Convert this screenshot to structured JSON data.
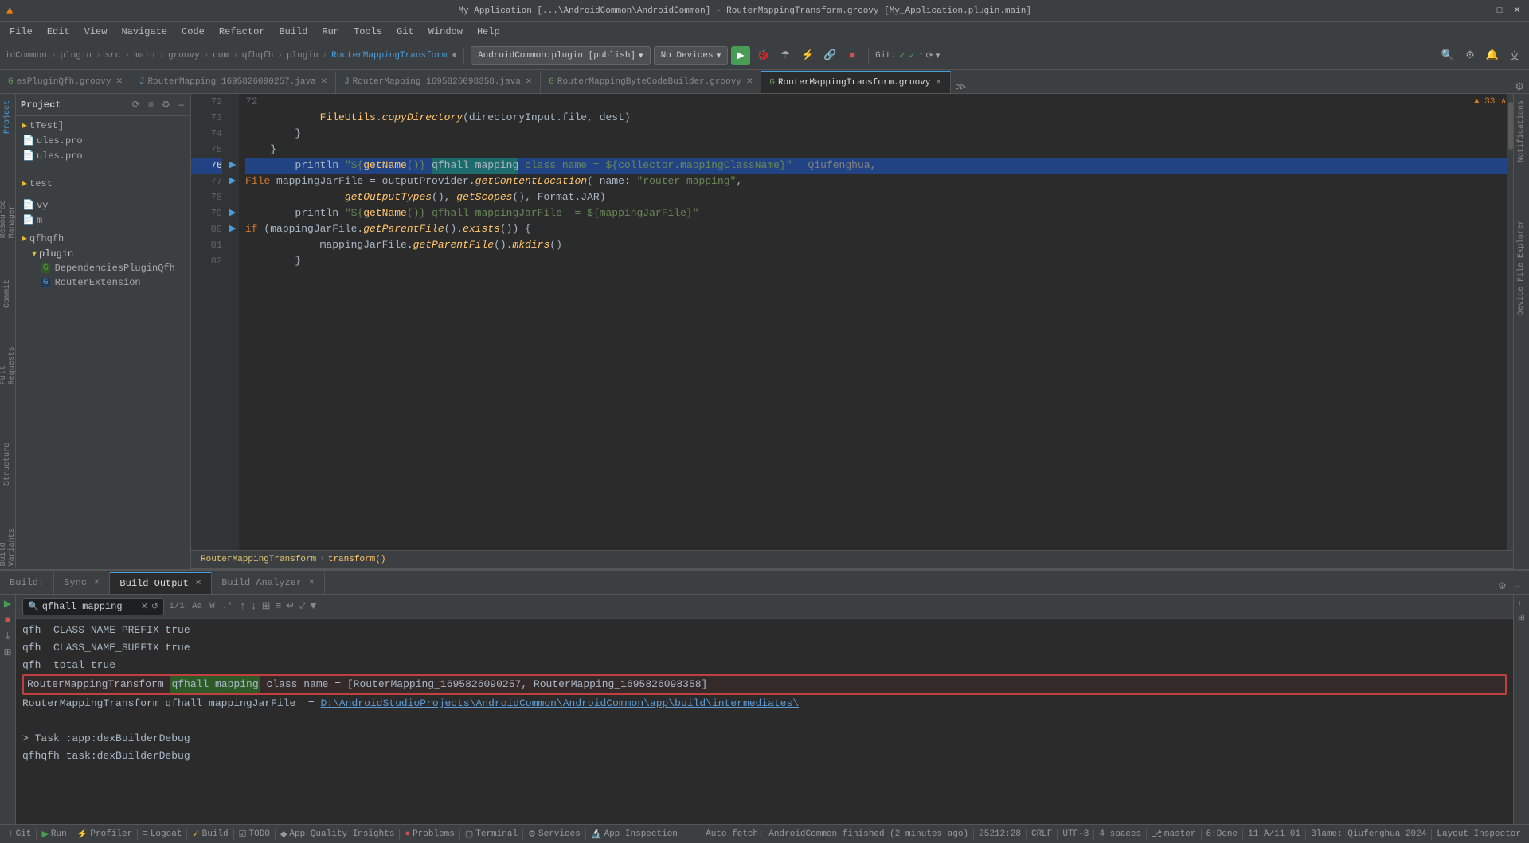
{
  "titlebar": {
    "title": "My Application [...\\AndroidCommon\\AndroidCommon] - RouterMappingTransform.groovy [My_Application.plugin.main]",
    "min": "─",
    "max": "□",
    "close": "✕"
  },
  "menubar": {
    "items": [
      "File",
      "Edit",
      "View",
      "Navigate",
      "Code",
      "Refactor",
      "Build",
      "Run",
      "Tools",
      "Git",
      "Window",
      "Help"
    ]
  },
  "toolbar": {
    "breadcrumbs": [
      "idCommon",
      "plugin",
      "src",
      "main",
      "groovy",
      "com",
      "qfhqfh",
      "plugin"
    ],
    "current_file": "RouterMappingTransform",
    "config": "AndroidCommon:plugin [publish]",
    "devices": "No Devices",
    "git_label": "Git:"
  },
  "tabs": {
    "items": [
      {
        "label": "esPluginQfh.groovy",
        "active": false
      },
      {
        "label": "RouterMapping_1695826090257.java",
        "active": false
      },
      {
        "label": "RouterMapping_1695826098358.java",
        "active": false
      },
      {
        "label": "RouterMappingByteCodeBuilder.groovy",
        "active": false
      },
      {
        "label": "RouterMappingTransform.groovy",
        "active": true
      }
    ]
  },
  "editor": {
    "lines": [
      {
        "num": "72",
        "content": "",
        "tokens": []
      },
      {
        "num": "73",
        "content": "            FileUtils.copyDirectory(directoryInput.file, dest)",
        "type": "normal"
      },
      {
        "num": "74",
        "content": "        }",
        "type": "normal"
      },
      {
        "num": "75",
        "content": "    }",
        "type": "normal"
      },
      {
        "num": "76",
        "content": "        println \"${getName()} qfhall mapping class name = ${collector.mappingClassName}\"",
        "type": "highlighted",
        "highlight_word": "qfhall mapping",
        "comment": "Qiufenghua,"
      },
      {
        "num": "77",
        "content": "        File mappingJarFile = outputProvider.getContentLocation( name: \"router_mapping\",",
        "type": "normal"
      },
      {
        "num": "78",
        "content": "                getOutputTypes(), getScopes(), Format.JAR)",
        "type": "normal"
      },
      {
        "num": "79",
        "content": "        println \"${getName()} qfhall mappingJarFile  = ${mappingJarFile}\"",
        "type": "normal"
      },
      {
        "num": "80",
        "content": "        if (mappingJarFile.getParentFile().exists()) {",
        "type": "normal"
      },
      {
        "num": "81",
        "content": "            mappingJarFile.getParentFile().mkdirs()",
        "type": "normal"
      },
      {
        "num": "82",
        "content": "        }",
        "type": "normal"
      }
    ],
    "breadcrumb": "RouterMappingTransform › transform()"
  },
  "build_panel": {
    "tabs": [
      {
        "label": "Build",
        "active": false,
        "closeable": false
      },
      {
        "label": "Sync",
        "active": false,
        "closeable": true
      },
      {
        "label": "Build Output",
        "active": true,
        "closeable": true
      },
      {
        "label": "Build Analyzer",
        "active": false,
        "closeable": true
      }
    ],
    "search_value": "qfhall mapping",
    "match_count": "1/1",
    "output_lines": [
      {
        "text": "qfh  CLASS_NAME_PREFIX true"
      },
      {
        "text": "qfh  CLASS_NAME_SUFFIX true"
      },
      {
        "text": "qfh  total true"
      },
      {
        "text": "RouterMappingTransform qfhall mapping class name = [RouterMapping_1695826090257, RouterMapping_1695826098358]",
        "highlight": true,
        "highlight_word": "qfhall mapping"
      },
      {
        "text": "RouterMappingTransform qfhall mappingJarFile  = D:\\AndroidStudioProjects\\AndroidCommon\\AndroidCommon\\app\\build\\intermediates\\",
        "link_start": 42
      },
      {
        "text": ""
      },
      {
        "text": "> Task :app:dexBuilderDebug"
      },
      {
        "text": "qfhqfh task:dexBuilderDebug"
      }
    ]
  },
  "status_bar": {
    "git_icon": "↑",
    "git_label": "Git",
    "run_label": "Run",
    "profiler_label": "Profiler",
    "logcat_label": "Logcat",
    "build_label": "Build",
    "todo_label": "TODO",
    "app_quality_label": "App Quality Insights",
    "problems_label": "Problems",
    "terminal_label": "Terminal",
    "services_label": "Services",
    "app_inspection_label": "App Inspection",
    "right_info": "25212:28   CRLF   UTF-8   4 spaces   Git:   ✓ ✓ ↑   ⟳   ⊕   6:Done   11 A/11 01   Blame: Qiufenghua 202",
    "auto_fetch": "Auto fetch: AndroidCommon finished (2 minutes ago)",
    "layout_inspector": "Layout Inspector"
  },
  "left_panel": {
    "project_label": "Project",
    "tree": [
      {
        "label": "tTest]",
        "level": 0,
        "type": "folder"
      },
      {
        "label": "ules.pro",
        "level": 0,
        "type": "file"
      },
      {
        "label": "ules.pro",
        "level": 0,
        "type": "file"
      },
      {
        "label": "test",
        "level": 0,
        "type": "folder"
      },
      {
        "label": "vy",
        "level": 0,
        "type": "file"
      },
      {
        "label": "m",
        "level": 0,
        "type": "file"
      },
      {
        "label": "qfhqfh",
        "level": 0,
        "type": "folder"
      },
      {
        "label": "plugin",
        "level": 1,
        "type": "folder",
        "open": true
      },
      {
        "label": "DependenciesPluginQfh",
        "level": 2,
        "type": "file",
        "color": "green"
      },
      {
        "label": "RouterExtension",
        "level": 2,
        "type": "file",
        "color": "blue"
      }
    ]
  },
  "icons": {
    "search": "🔍",
    "close": "✕",
    "settings": "⚙",
    "run": "▶",
    "stop": "■",
    "build": "🔨",
    "folder": "📁",
    "file": "📄",
    "arrow_right": "›",
    "arrow_down": "▾",
    "chevron": "❯",
    "filter": "⊞",
    "wrap": "↵",
    "match_case": "Aa",
    "words": "W",
    "regex": ".*",
    "up_arrow": "↑",
    "down_arrow": "↓",
    "expand": "⊞"
  }
}
